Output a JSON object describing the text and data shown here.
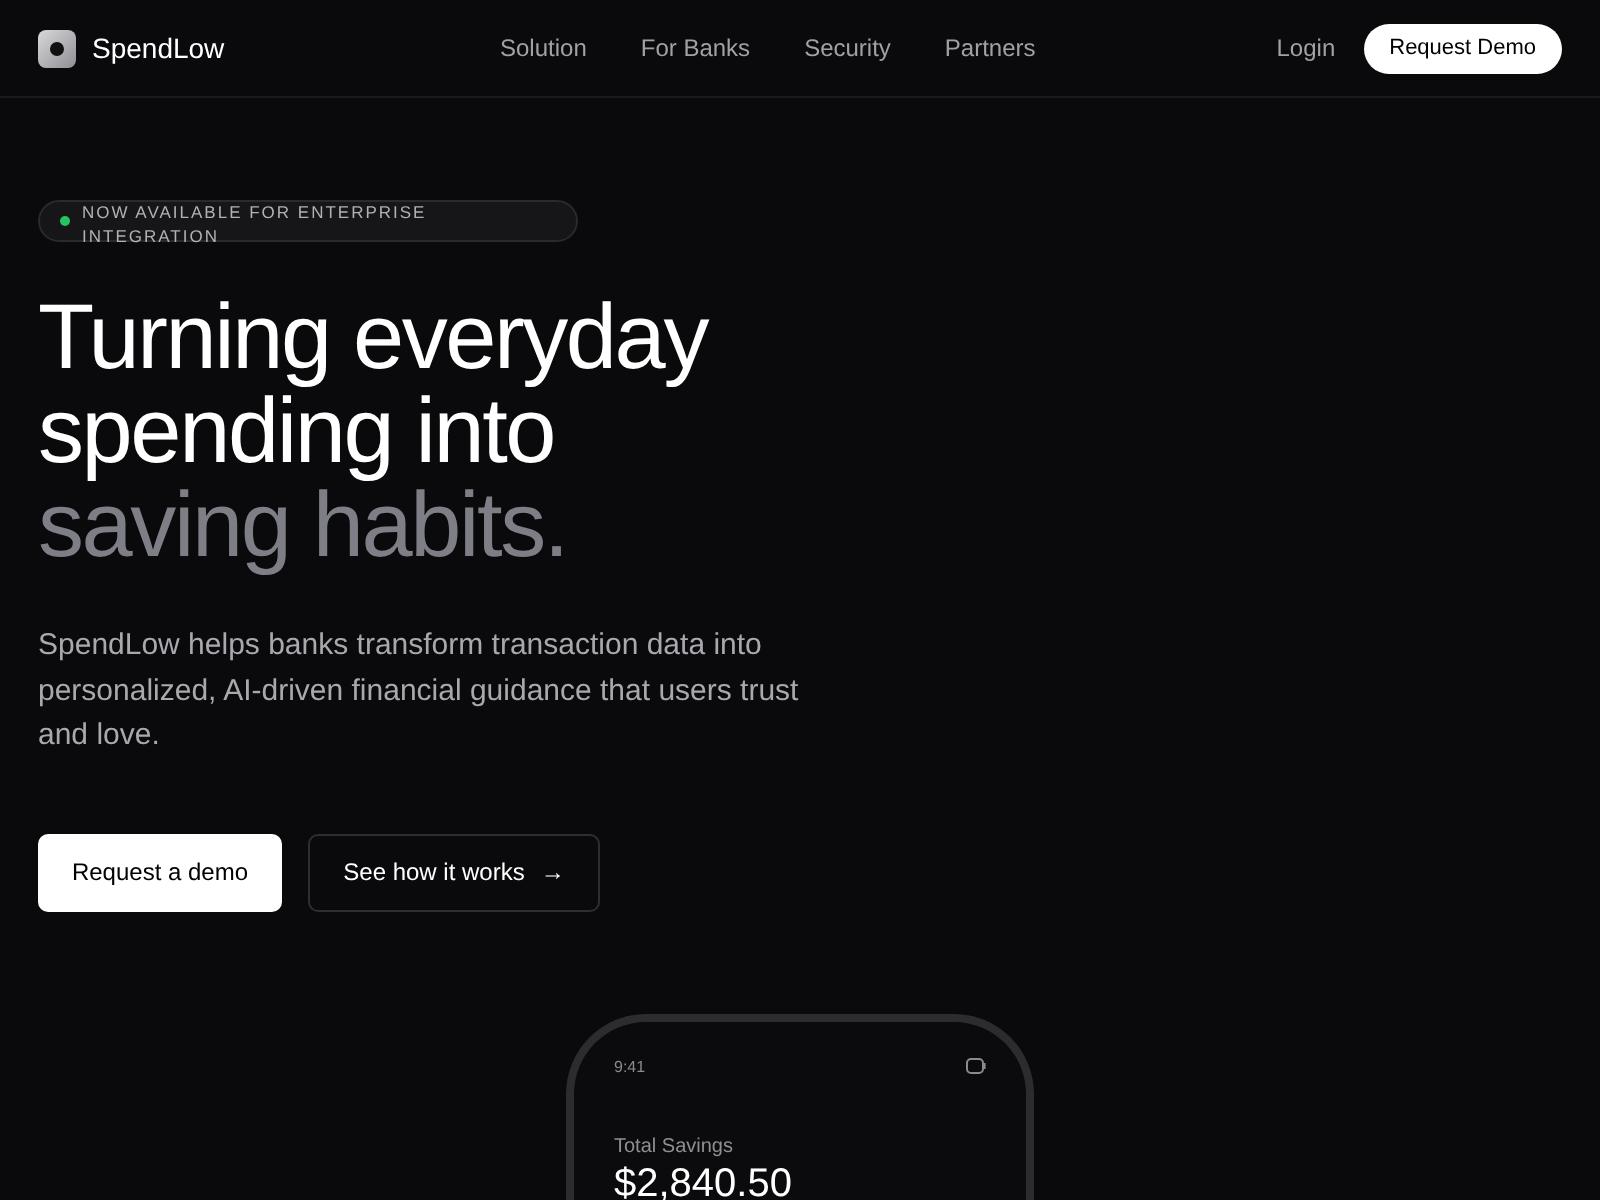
{
  "brand": {
    "name": "SpendLow"
  },
  "nav": {
    "links": [
      "Solution",
      "For Banks",
      "Security",
      "Partners"
    ],
    "login": "Login",
    "cta": "Request Demo"
  },
  "badge": {
    "text": "NOW AVAILABLE FOR ENTERPRISE INTEGRATION",
    "color": "#22c55e"
  },
  "headline": {
    "lines": [
      "Turning everyday",
      "spending into"
    ],
    "muted": "saving habits."
  },
  "description": "SpendLow helps banks transform transaction data into personalized, AI-driven financial guidance that users trust and love.",
  "buttons": [
    {
      "label": "Request a demo",
      "kind": "primary"
    },
    {
      "label": "See how it works",
      "kind": "secondary",
      "arrow": "→"
    }
  ],
  "phone": {
    "time": "9:41",
    "label": "Total Savings",
    "amount": "$2,840.50"
  }
}
